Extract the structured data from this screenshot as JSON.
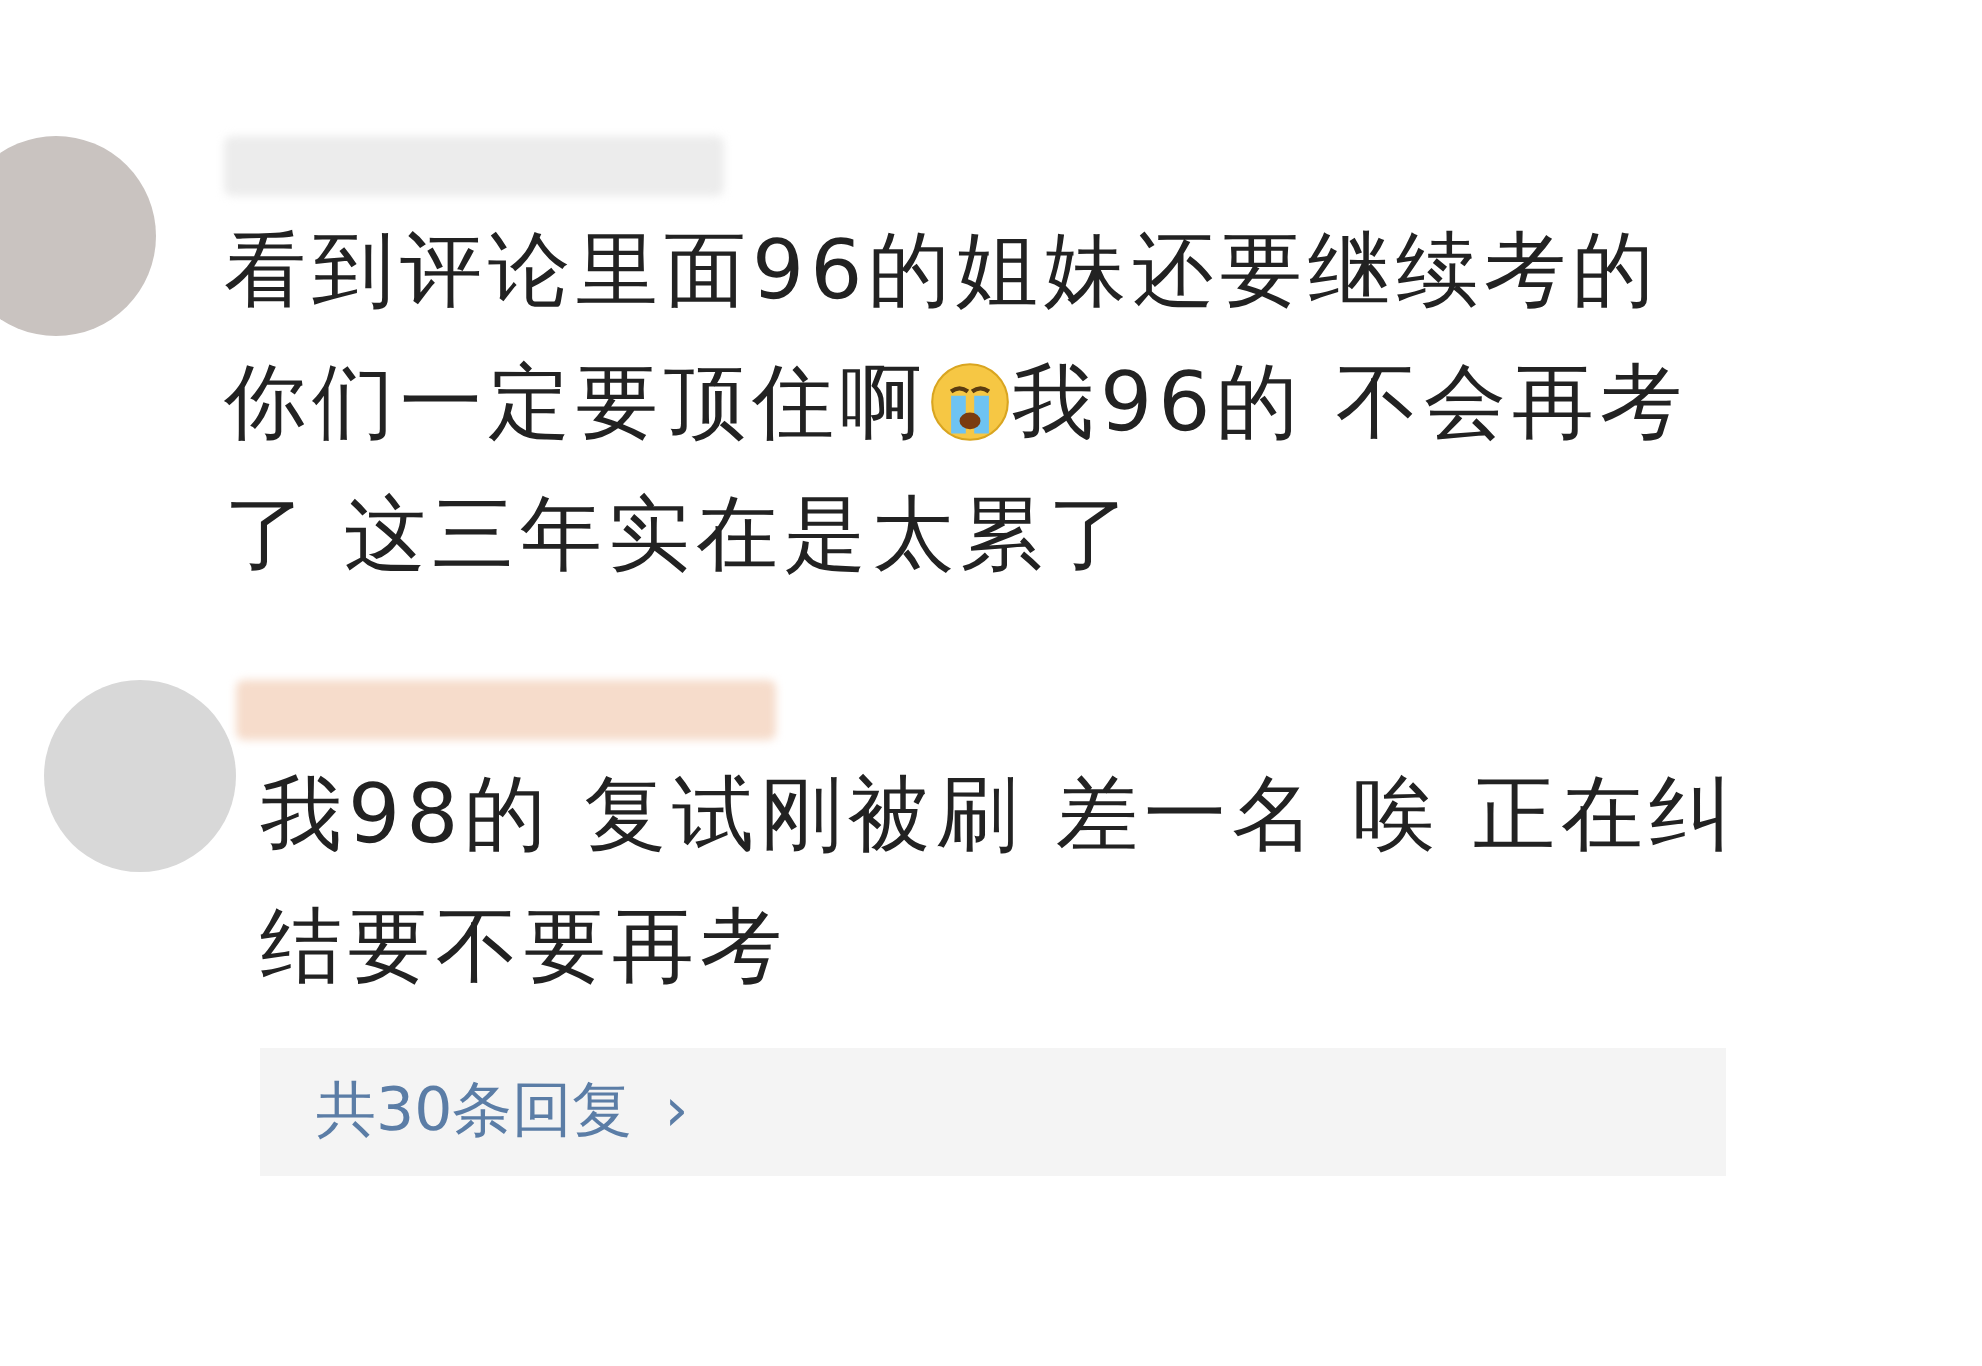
{
  "comments": [
    {
      "lines": [
        [
          {
            "kind": "text",
            "text": "看到评论里面96的姐妹还要继续考的"
          }
        ],
        [
          {
            "kind": "text",
            "text": "你们一定要顶住啊"
          },
          {
            "kind": "emoji"
          },
          {
            "kind": "text",
            "text": "我96的 不会再考"
          }
        ],
        [
          {
            "kind": "text",
            "text": "了 这三年实在是太累了"
          }
        ]
      ]
    },
    {
      "lines": [
        [
          {
            "kind": "text",
            "text": "我98的 复试刚被刷 差一名 唉 正在纠"
          }
        ],
        [
          {
            "kind": "text",
            "text": "结要不要再考"
          }
        ]
      ],
      "replies": {
        "label": "共30条回复",
        "arrow": "›"
      }
    }
  ]
}
